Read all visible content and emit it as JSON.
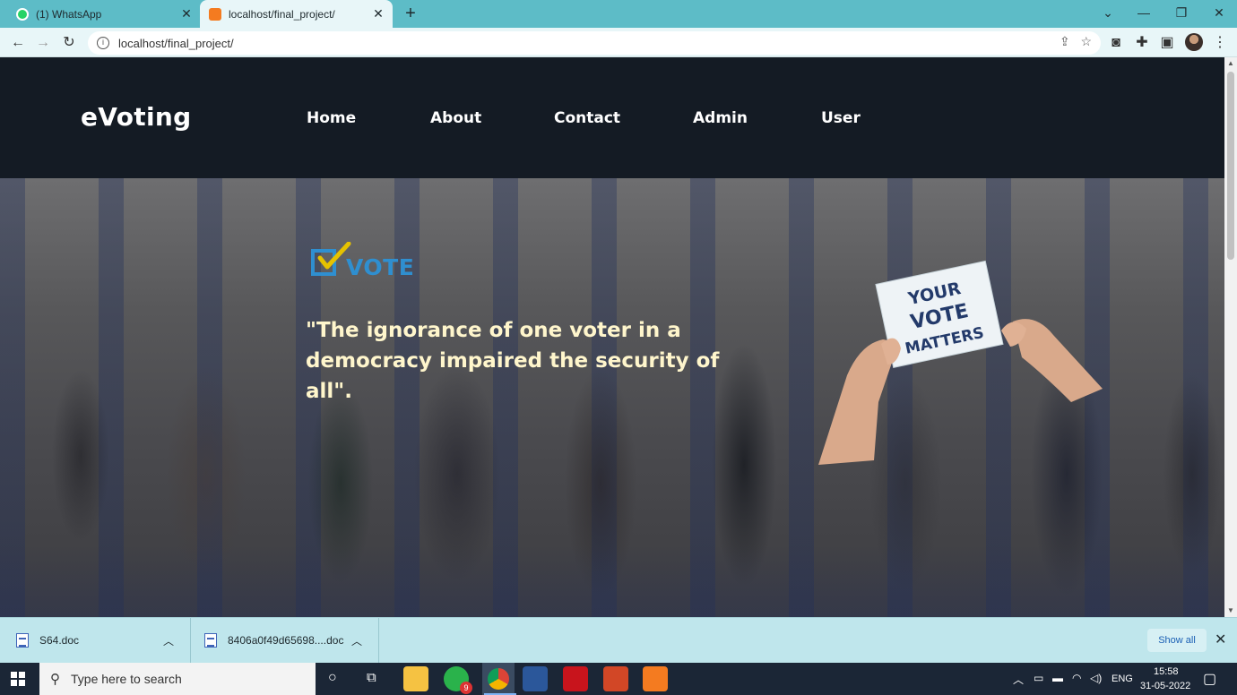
{
  "browser": {
    "tabs": [
      {
        "title": "(1) WhatsApp",
        "active": false
      },
      {
        "title": "localhost/final_project/",
        "active": true
      }
    ],
    "url": "localhost/final_project/"
  },
  "site": {
    "brand": "eVoting",
    "nav": [
      "Home",
      "About",
      "Contact",
      "Admin",
      "User"
    ],
    "logo_text": "VOTE",
    "quote_line1": "\"The ignorance of one voter in a",
    "quote_line2": "democracy impaired the security of all\".",
    "card_text": [
      "YOUR",
      "VOTE",
      "MATTERS"
    ]
  },
  "downloads": {
    "items": [
      "S64.doc",
      "8406a0f49d65698....doc"
    ],
    "show_all": "Show all"
  },
  "taskbar": {
    "search_placeholder": "Type here to search",
    "whatsapp_badge": "9",
    "language": "ENG",
    "time": "15:58",
    "date": "31-05-2022"
  },
  "colors": {
    "tab_strip": "#5dbcc7",
    "navbar": "#141b24",
    "quote": "#fff6cc",
    "vote_blue": "#2f8fd0",
    "check_yellow": "#e6c200"
  }
}
